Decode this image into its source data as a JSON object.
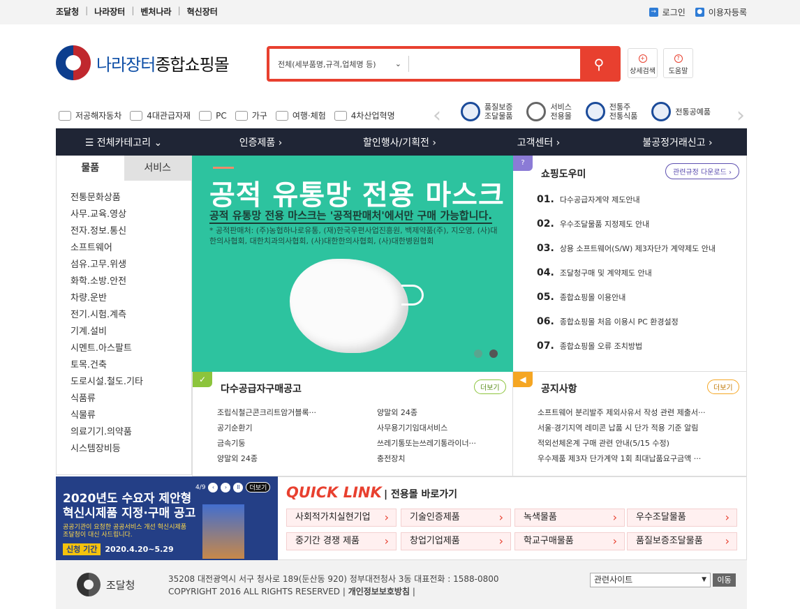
{
  "top": {
    "links": [
      "조달청",
      "나라장터",
      "벤처나라",
      "혁신장터"
    ],
    "login": "로그인",
    "register": "이용자등록"
  },
  "header": {
    "logo_a": "나라장터",
    "logo_b": "종합쇼핑몰",
    "search_category": "전체(세부품명,규격,업체명 등)",
    "search_value": "",
    "detail_search": "상세검색",
    "help": "도움말"
  },
  "categories": [
    "저공해자동차",
    "4대관급자재",
    "PC",
    "가구",
    "여행·체험",
    "4차산업혁명"
  ],
  "malls": [
    {
      "l1": "품질보증",
      "l2": "조달물품"
    },
    {
      "l1": "서비스",
      "l2": "전용몰"
    },
    {
      "l1": "전통주",
      "l2": "전통식품"
    },
    {
      "l1": "전통공예품",
      "l2": ""
    }
  ],
  "nav": [
    "전체카테고리",
    "인증제품",
    "할인행사/기획전",
    "고객센터",
    "불공정거래신고"
  ],
  "left": {
    "tab_goods": "물품",
    "tab_service": "서비스",
    "items": [
      "전통문화상품",
      "사무.교육.영상",
      "전자.정보.통신",
      "소프트웨어",
      "섬유.고무.위생",
      "화학.소방.안전",
      "차량.운반",
      "전기.시험.계측",
      "기계.설비",
      "시멘트.아스팔트",
      "토목.건축",
      "도로시설.철도.기타",
      "식품류",
      "식물류",
      "의료기기.의약품",
      "시스템장비등"
    ]
  },
  "banner": {
    "title": "공적 유통망 전용 마스크",
    "subtitle": "공적 유통망 전용 마스크는 '공적판매처'에서만 구매 가능합니다.",
    "note": "* 공적판매처: (주)농협하나로유통, (재)한국우편사업진흥원, 백제약품(주), 지오영, (사)대한의사협회, 대한치과의사협회, (사)대한한의사협회, (사)대한병원협회"
  },
  "helper": {
    "title": "쇼핑도우미",
    "download": "관련규정 다운로드 ›",
    "items": [
      {
        "n": "01.",
        "t": "다수공급자계약 제도안내"
      },
      {
        "n": "02.",
        "t": "우수조달물품 지정제도 안내"
      },
      {
        "n": "03.",
        "t": "상용 소프트웨어(S/W) 제3자단가 계약제도 안내"
      },
      {
        "n": "04.",
        "t": "조달청구매 및 계약제도 안내"
      },
      {
        "n": "05.",
        "t": "종합쇼핑몰 이용안내"
      },
      {
        "n": "06.",
        "t": "종합쇼핑몰 처음 이용시 PC 환경설정"
      },
      {
        "n": "07.",
        "t": "종합쇼핑몰 오류 조치방법"
      }
    ]
  },
  "tender": {
    "title": "다수공급자구매공고",
    "more": "더보기",
    "col1": [
      "조립식철근콘크리트암거블록···",
      "공기순환기",
      "금속기둥",
      "양말외 24종"
    ],
    "col2": [
      "양말외 24종",
      "사무용기기임대서비스",
      "쓰레기통또는쓰레기통라이너···",
      "충전장치"
    ]
  },
  "notice": {
    "title": "공지사항",
    "more": "더보기",
    "items": [
      "소프트웨어 분리발주 제외사유서 작성 관련 제출서···",
      "서울·경기지역 레미콘 납품 시 단가 적용 기준 알림",
      "적외선체온계 구매 관련 안내(5/15 수정)",
      "우수제품 제3자 단가계약 1회 최대납품요구금액 ···"
    ]
  },
  "promo": {
    "counter": "4/9",
    "more": "더보기",
    "line1": "2020년도 수요자 제안형",
    "line2": "혁신시제품 지정·구매 공고",
    "small1": "공공기관이 요청한 공공서비스 개선 혁신시제품",
    "small2": "조달청이 대신 사드립니다.",
    "period_label": "신청 기간",
    "period": "2020.4.20~5.29"
  },
  "quick": {
    "title": "QUICK LINK",
    "sub": "전용몰 바로가기",
    "links": [
      "사회적가치실현기업",
      "기술인증제품",
      "녹색물품",
      "우수조달물품",
      "중기간 경쟁 제품",
      "창업기업제품",
      "학교구매물품",
      "품질보증조달물품"
    ]
  },
  "footer": {
    "logo": "조달청",
    "addr": "35208 대전광역시 서구 청사로 189(둔산동 920) 정부대전청사 3동 대표전화 : 1588-0800",
    "copy": "COPYRIGHT 2016 ALL RIGHTS RESERVED",
    "privacy": "개인정보보호방침",
    "related": "관련사이트",
    "go": "이동"
  }
}
